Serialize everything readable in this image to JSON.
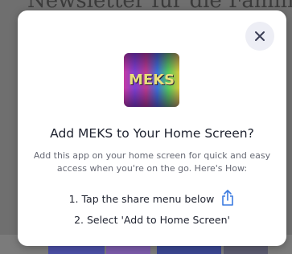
{
  "background": {
    "title_fragment": "Newsletter für die Familie"
  },
  "modal": {
    "app_name_logo": "MEKS",
    "title": "Add MEKS to Your Home Screen?",
    "description": "Add this app on your home screen for quick and easy access when you're on the go. Here's How:",
    "step1": "1. Tap the share menu below",
    "step2": "2. Select 'Add to Home Screen'",
    "close_icon": "close-icon",
    "share_icon": "share-icon"
  },
  "colors": {
    "accent": "#3b7be0",
    "close_button_bg": "#edeef5",
    "title_text": "#1f2330",
    "description_text": "#676a75"
  }
}
